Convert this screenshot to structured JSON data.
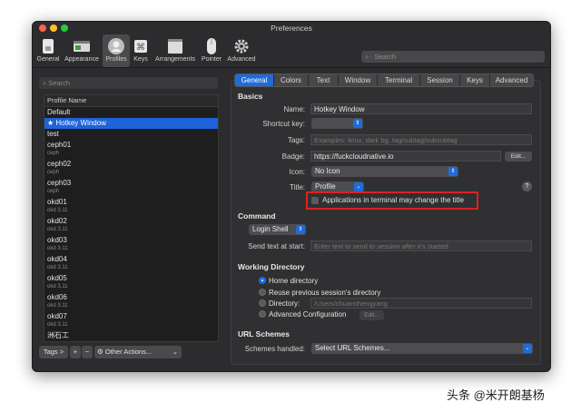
{
  "window": {
    "title": "Preferences"
  },
  "toolbar": {
    "items": [
      {
        "label": "General",
        "icon": "switch-icon"
      },
      {
        "label": "Appearance",
        "icon": "appearance-icon"
      },
      {
        "label": "Profiles",
        "icon": "profile-icon"
      },
      {
        "label": "Keys",
        "icon": "keys-icon"
      },
      {
        "label": "Arrangements",
        "icon": "arrangements-icon"
      },
      {
        "label": "Pointer",
        "icon": "mouse-icon"
      },
      {
        "label": "Advanced",
        "icon": "gear-icon"
      }
    ],
    "selected": "Profiles",
    "search_placeholder": "Search"
  },
  "profiles": {
    "search_placeholder": "Search",
    "header": "Profile Name",
    "items": [
      {
        "name": "Default",
        "sub": ""
      },
      {
        "name": "★ Hotkey Window",
        "sub": "",
        "selected": true
      },
      {
        "name": "test",
        "sub": ""
      },
      {
        "name": "ceph01",
        "sub": "ceph"
      },
      {
        "name": "ceph02",
        "sub": "ceph"
      },
      {
        "name": "ceph03",
        "sub": "ceph"
      },
      {
        "name": "okd01",
        "sub": "okd 3.11"
      },
      {
        "name": "okd02",
        "sub": "okd 3.11"
      },
      {
        "name": "okd03",
        "sub": "okd 3.11"
      },
      {
        "name": "okd04",
        "sub": "okd 3.11"
      },
      {
        "name": "okd05",
        "sub": "okd 3.11"
      },
      {
        "name": "okd06",
        "sub": "okd 3.11"
      },
      {
        "name": "okd07",
        "sub": "okd 3.11"
      },
      {
        "name": "洲石工",
        "sub": ""
      }
    ],
    "tags_button": "Tags >",
    "add_button": "+",
    "remove_button": "−",
    "other_actions": "Other Actions..."
  },
  "tabs": [
    "General",
    "Colors",
    "Text",
    "Window",
    "Terminal",
    "Session",
    "Keys",
    "Advanced"
  ],
  "selected_tab": "General",
  "basics": {
    "heading": "Basics",
    "name_label": "Name:",
    "name_value": "Hotkey Window",
    "shortcut_label": "Shortcut key:",
    "tags_label": "Tags:",
    "tags_placeholder": "Examples: linux, dark bg, tag/subtag/subsubtag",
    "badge_label": "Badge:",
    "badge_value": "https://fuckcloudnative.io",
    "badge_edit": "Edit...",
    "icon_label": "Icon:",
    "icon_value": "No Icon",
    "title_label": "Title:",
    "title_value": "Profile",
    "title_help": "?",
    "apps_change_title": "Applications in terminal may change the title"
  },
  "command": {
    "heading": "Command",
    "shell_value": "Login Shell",
    "send_text_label": "Send text at start:",
    "send_text_placeholder": "Enter text to send to session after it’s started"
  },
  "working_directory": {
    "heading": "Working Directory",
    "home": "Home directory",
    "reuse": "Reuse previous session's directory",
    "directory": "Directory:",
    "directory_path": "/Users/chuanshengyang",
    "advanced": "Advanced Configuration",
    "advanced_edit": "Edit..."
  },
  "url_schemes": {
    "heading": "URL Schemes",
    "label": "Schemes handled:",
    "value": "Select URL Schemes..."
  },
  "watermark": "头条 @米开朗基杨",
  "colors": {
    "accent": "#1f6bd9",
    "highlight": "#e02020",
    "window_bg": "#2c2c2e"
  }
}
